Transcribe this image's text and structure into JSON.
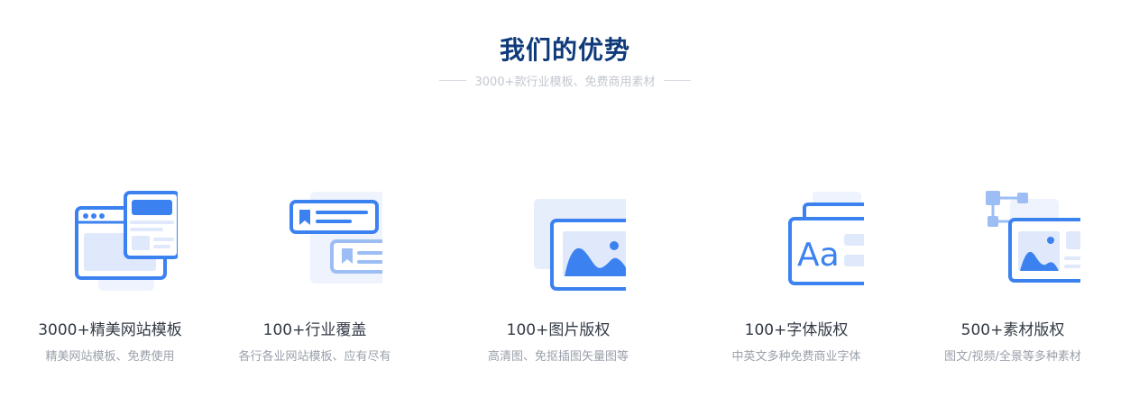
{
  "section": {
    "title": "我们的优势",
    "subtitle": "3000+款行业模板、免费商用素材"
  },
  "features": [
    {
      "icon": "website-template-icon",
      "name": "3000+精美网站模板",
      "desc": "精美网站模板、免费使用"
    },
    {
      "icon": "industry-cards-icon",
      "name": "100+行业覆盖",
      "desc": "各行各业网站模板、应有尽有"
    },
    {
      "icon": "image-copyright-icon",
      "name": "100+图片版权",
      "desc": "高清图、免抠插图矢量图等"
    },
    {
      "icon": "font-copyright-icon",
      "name": "100+字体版权",
      "desc": "中英文多种免费商业字体"
    },
    {
      "icon": "material-copyright-icon",
      "name": "500+素材版权",
      "desc": "图文/视频/全景等多种素材"
    }
  ],
  "colors": {
    "accent": "#3b82f0",
    "light": "#dfe9fb",
    "title": "#0f3a7a"
  }
}
